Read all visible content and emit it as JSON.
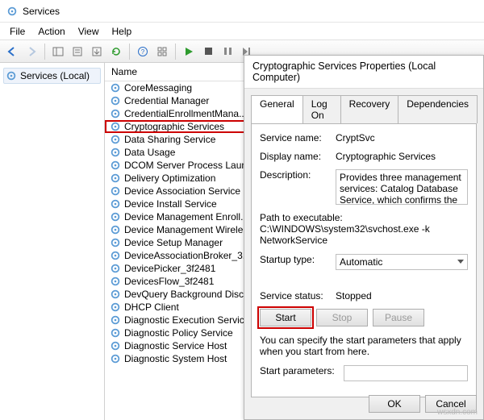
{
  "window": {
    "title": "Services"
  },
  "menu": {
    "file": "File",
    "action": "Action",
    "view": "View",
    "help": "Help"
  },
  "leftpane": {
    "label": "Services (Local)"
  },
  "list": {
    "header": "Name",
    "items": [
      "CoreMessaging",
      "Credential Manager",
      "CredentialEnrollmentMana...",
      "Cryptographic Services",
      "Data Sharing Service",
      "Data Usage",
      "DCOM Server Process Laun...",
      "Delivery Optimization",
      "Device Association Service",
      "Device Install Service",
      "Device Management Enroll...",
      "Device Management Wirele...",
      "Device Setup Manager",
      "DeviceAssociationBroker_3...",
      "DevicePicker_3f2481",
      "DevicesFlow_3f2481",
      "DevQuery Background Disc...",
      "DHCP Client",
      "Diagnostic Execution Service",
      "Diagnostic Policy Service",
      "Diagnostic Service Host",
      "Diagnostic System Host"
    ],
    "selected_index": 3
  },
  "dialog": {
    "title": "Cryptographic Services Properties (Local Computer)",
    "tabs": {
      "general": "General",
      "logon": "Log On",
      "recovery": "Recovery",
      "dependencies": "Dependencies"
    },
    "fields": {
      "service_name_label": "Service name:",
      "service_name_value": "CryptSvc",
      "display_name_label": "Display name:",
      "display_name_value": "Cryptographic Services",
      "description_label": "Description:",
      "description_value": "Provides three management services: Catalog Database Service, which confirms the signatures of Windows files and allows new programs",
      "path_label": "Path to executable:",
      "path_value": "C:\\WINDOWS\\system32\\svchost.exe -k NetworkService",
      "startup_label": "Startup type:",
      "startup_value": "Automatic",
      "status_label": "Service status:",
      "status_value": "Stopped",
      "note": "You can specify the start parameters that apply when you start from here.",
      "start_params_label": "Start parameters:"
    },
    "buttons": {
      "start": "Start",
      "stop": "Stop",
      "pause": "Pause",
      "ok": "OK",
      "cancel": "Cancel"
    }
  },
  "watermark": "wsxdn.com"
}
